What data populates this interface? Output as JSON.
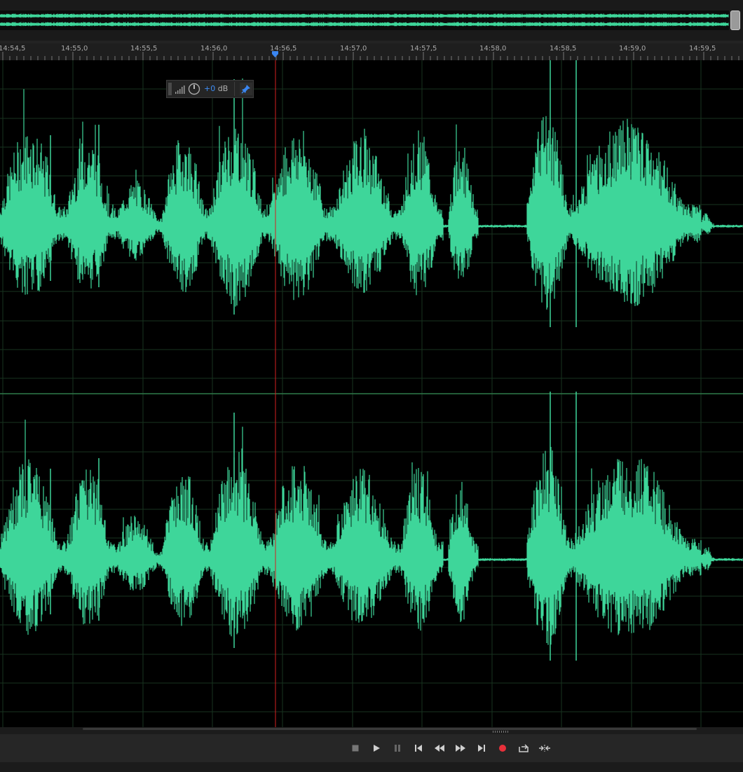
{
  "ruler": {
    "labels": [
      "14:54,5",
      "14:55,0",
      "14:55,5",
      "14:56,0",
      "14:56,5",
      "14:57,0",
      "14:57,5",
      "14:58,0",
      "14:58,5",
      "14:59,0",
      "14:59,5"
    ]
  },
  "hud": {
    "gain_value": "+0",
    "gain_unit": "dB"
  },
  "colors": {
    "waveform": "#3ed69a",
    "playhead": "#d42020",
    "playhead_marker": "#3a86f0",
    "record": "#e8303a"
  },
  "transport": {
    "buttons": [
      "stop",
      "play",
      "pause",
      "go-to-start",
      "rewind",
      "fast-forward",
      "go-to-end",
      "record",
      "loop",
      "skip-selection"
    ]
  }
}
